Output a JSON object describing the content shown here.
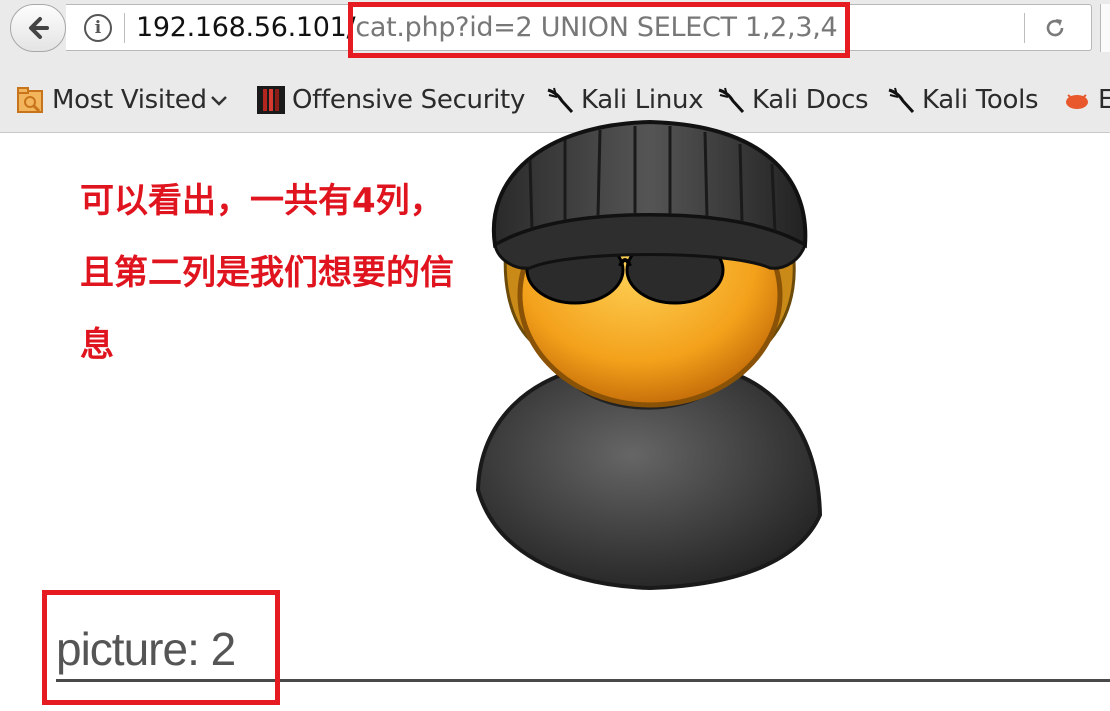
{
  "browser": {
    "url_host": "192.168.56.101/",
    "url_path": "cat.php?id=2 UNION SELECT 1,2,3,4",
    "bookmarks": [
      {
        "label": "Most Visited",
        "icon": "most-visited-folder-icon"
      },
      {
        "label": "Offensive Security",
        "icon": "offensive-security-icon"
      },
      {
        "label": "Kali Linux",
        "icon": "kali-dragon-icon"
      },
      {
        "label": "Kali Docs",
        "icon": "kali-dragon-icon"
      },
      {
        "label": "Kali Tools",
        "icon": "kali-dragon-icon"
      },
      {
        "label": "E",
        "icon": "exploit-db-icon"
      }
    ]
  },
  "page": {
    "annotation": "可以看出，一共有4列，且第二列是我们想要的信息",
    "picture_label": "picture: 2"
  },
  "colors": {
    "highlight_red": "#e61b22",
    "annotation_red": "#e0141e"
  }
}
